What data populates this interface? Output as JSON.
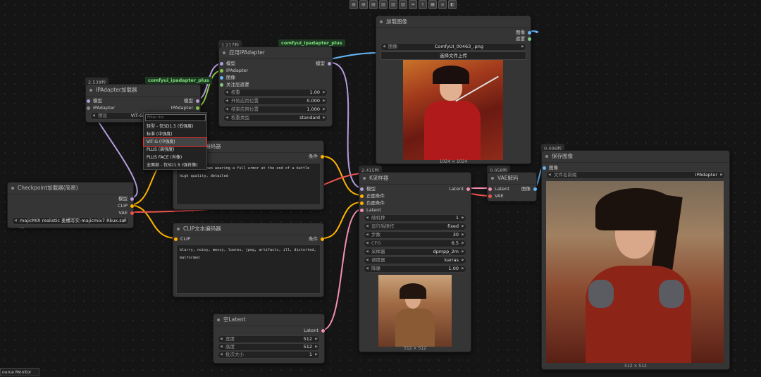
{
  "toolbar": {
    "icons": [
      "align-left-icon",
      "align-center-icon",
      "align-right-icon",
      "align-top-icon",
      "align-middle-icon",
      "align-bottom-icon",
      "distribute-h-icon",
      "distribute-v-icon",
      "grid-icon",
      "stack-icon",
      "fit-icon"
    ]
  },
  "checkpoint": {
    "title": "Checkpoint加载器(简易)",
    "out_model": "模型",
    "out_clip": "CLIP",
    "out_vae": "VAE",
    "ckpt": "majicMIX realistic 麦橘写实-majicmix7 Rkux.saf ..."
  },
  "ipa_loader": {
    "time": "2.538秒",
    "badge": "comfyui_ipadapter_plus",
    "title": "IPAdapter加载器",
    "in_model": "模型",
    "in_ipadapter": "IPAdapter",
    "out_model": "模型",
    "out_ipadapter": "IPAdapter",
    "preset_label": "预设",
    "preset_value": "VIT-G",
    "filter_placeholder": "Filter list",
    "options": [
      "轻型 - 仅SD1.5 (低强度)",
      "标准 (中强度)",
      "VIT-G (中强度)",
      "PLUS (高强度)",
      "PLUS FACE (肖像)",
      "全面部 - 仅SD1.5 (强肖像)"
    ]
  },
  "apply_ipa": {
    "time": "1.217秒",
    "badge": "comfyui_ipadapter_plus",
    "title": "应用IPAdapter",
    "in_model": "模型",
    "in_ipadapter": "IPAdapter",
    "in_image": "图像",
    "in_mask": "关注层遮罩",
    "out_model": "模型",
    "weight_label": "权重",
    "weight": "1.00",
    "start_label": "开始应用位置",
    "start": "0.000",
    "end_label": "结束应用位置",
    "end": "1.000",
    "type_label": "权重类型",
    "type": "standard"
  },
  "load_image": {
    "title": "加载图像",
    "out_image": "图像",
    "out_mask": "遮罩",
    "image_label": "图像",
    "image_value": "ComfyUI_00463_.png",
    "upload": "选择文件上传",
    "size": "1024 × 1024"
  },
  "clip_pos": {
    "title": "CLIP文本编码器",
    "out": "条件",
    "text": "a warrior woman wearing a full armor at the end of a battle high quality, detailed"
  },
  "clip_neg": {
    "title": "CLIP文本编码器",
    "in_clip": "CLIP",
    "out": "条件",
    "text": "blurry, noisy, messy, lowres, jpeg, artifacts, ill, distorted, malformed"
  },
  "empty_latent": {
    "title": "空Latent",
    "out": "Latent",
    "w_label": "宽度",
    "w": "512",
    "h_label": "高度",
    "h": "512",
    "b_label": "批次大小",
    "b": "1"
  },
  "ksampler": {
    "time": "2.415秒",
    "title": "K采样器",
    "in_model": "模型",
    "in_pos": "正面条件",
    "in_neg": "负面条件",
    "in_latent": "Latent",
    "out": "Latent",
    "seed_label": "随机种",
    "seed": "1",
    "ctrl_label": "运行后操作",
    "ctrl": "fixed",
    "steps_label": "步数",
    "steps": "30",
    "cfg_label": "CFG",
    "cfg": "6.5",
    "sampler_label": "采样器",
    "sampler": "dpmpp_2m",
    "sched_label": "调度器",
    "sched": "karras",
    "denoise_label": "降噪",
    "denoise": "1.00",
    "size": "512 × 512"
  },
  "vae_decode": {
    "time": "0.058秒",
    "title": "VAE解码",
    "in_latent": "Latent",
    "in_vae": "VAE",
    "out": "图像"
  },
  "save_image": {
    "time": "0.406秒",
    "title": "保存图像",
    "in_image": "图像",
    "prefix_label": "文件名前缀",
    "prefix": "IPAdapter",
    "size": "512 × 512"
  },
  "status": {
    "resource_monitor": "ource Monitor"
  }
}
